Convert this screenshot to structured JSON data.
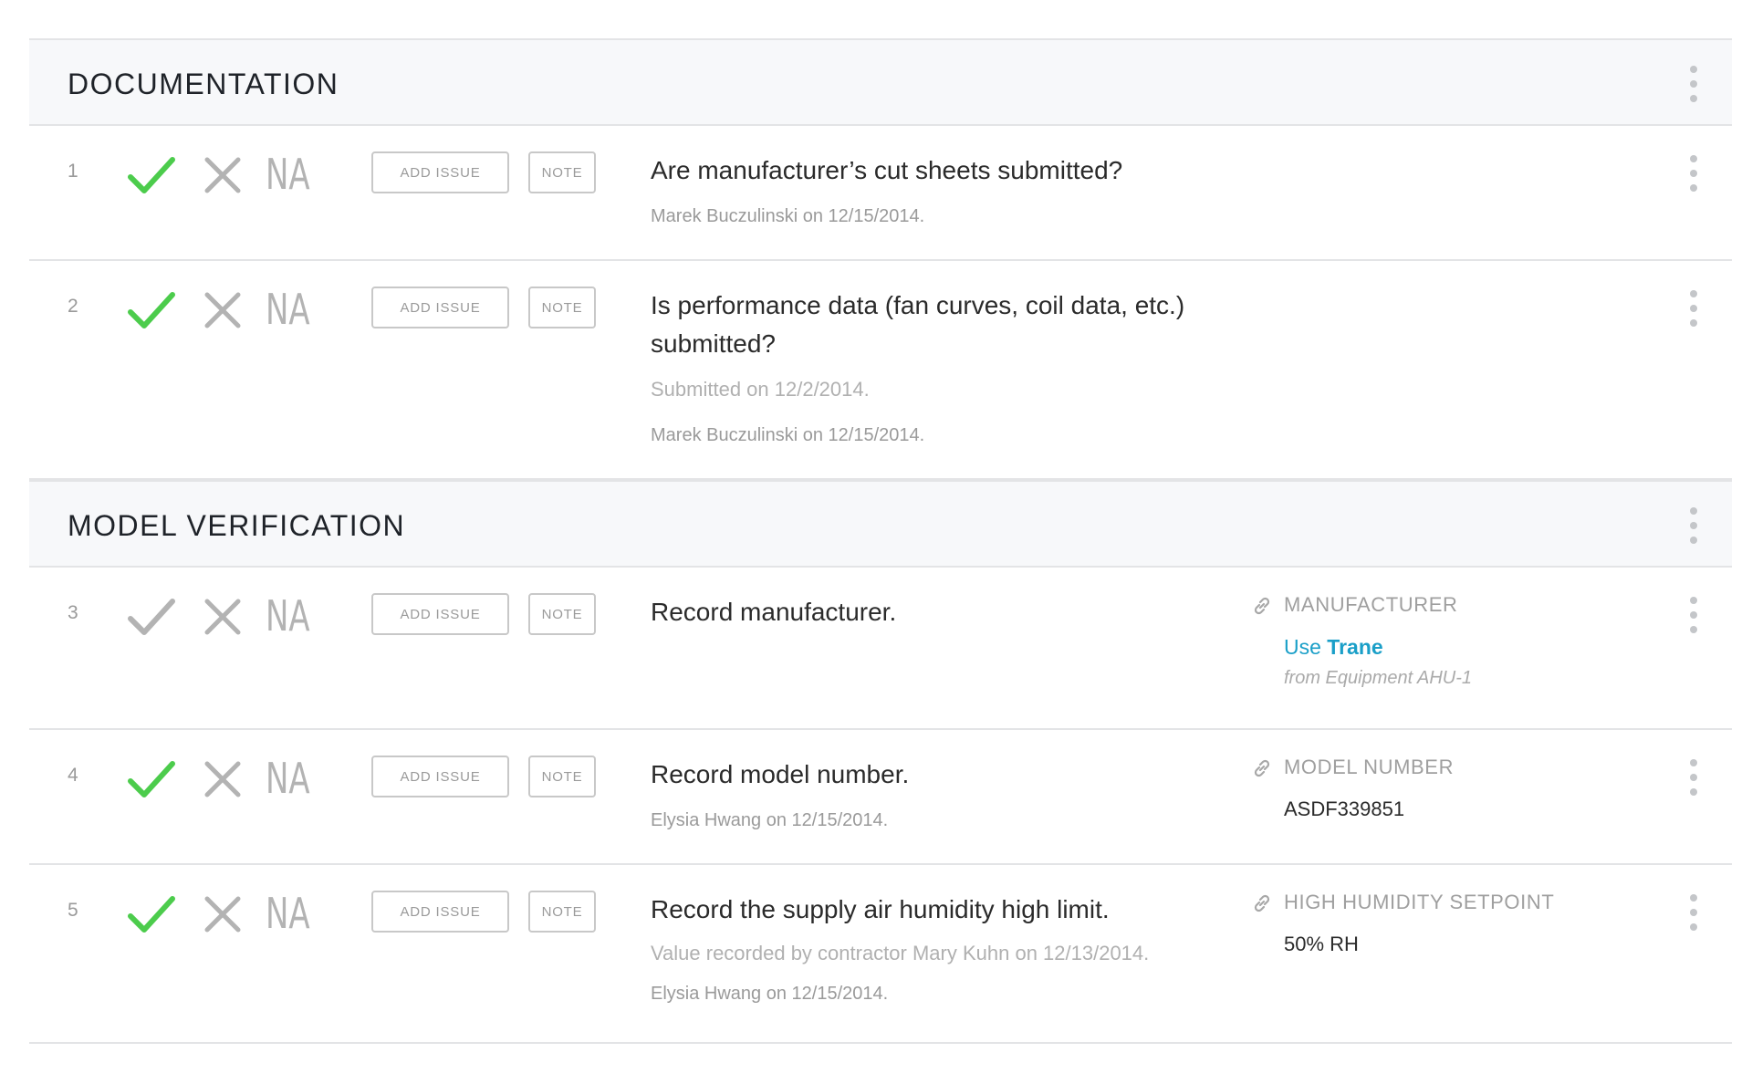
{
  "colors": {
    "check_active": "#4ccc4c",
    "check_inactive": "#b3b3b3",
    "x_mark": "#b3b3b3",
    "link": "#1a9fc8"
  },
  "icons": {
    "check": "check-icon",
    "x": "x-icon",
    "kebab": "kebab-menu-icon",
    "link": "link-icon"
  },
  "sections": [
    {
      "title": "DOCUMENTATION",
      "rows": [
        {
          "number": "1",
          "checked": true,
          "na_label": "NA",
          "add_issue_label": "ADD ISSUE",
          "note_label": "NOTE",
          "question": "Are manufacturer’s cut sheets submitted?",
          "notes": [],
          "signoff": "Marek Buczulinski on 12/15/2014."
        },
        {
          "number": "2",
          "checked": true,
          "na_label": "NA",
          "add_issue_label": "ADD ISSUE",
          "note_label": "NOTE",
          "question": "Is performance data (fan curves, coil data, etc.) submitted?",
          "notes": [
            "Submitted on 12/2/2014."
          ],
          "signoff": "Marek Buczulinski on 12/15/2014."
        }
      ]
    },
    {
      "title": "MODEL VERIFICATION",
      "rows": [
        {
          "number": "3",
          "checked": false,
          "na_label": "NA",
          "add_issue_label": "ADD ISSUE",
          "note_label": "NOTE",
          "question": "Record manufacturer.",
          "field": {
            "label": "MANUFACTURER",
            "use_prefix": "Use",
            "use_value": "Trane",
            "from_note": "from Equipment AHU-1"
          }
        },
        {
          "number": "4",
          "checked": true,
          "na_label": "NA",
          "add_issue_label": "ADD ISSUE",
          "note_label": "NOTE",
          "question": "Record model number.",
          "signoff": "Elysia Hwang on 12/15/2014.",
          "field": {
            "label": "MODEL NUMBER",
            "value": "ASDF339851"
          }
        },
        {
          "number": "5",
          "checked": true,
          "na_label": "NA",
          "add_issue_label": "ADD ISSUE",
          "note_label": "NOTE",
          "question": "Record the supply air humidity high limit.",
          "notes": [
            "Value recorded by contractor Mary Kuhn on 12/13/2014."
          ],
          "signoff": "Elysia Hwang on 12/15/2014.",
          "field": {
            "label": "HIGH HUMIDITY SETPOINT",
            "value": "50% RH"
          }
        }
      ]
    }
  ]
}
